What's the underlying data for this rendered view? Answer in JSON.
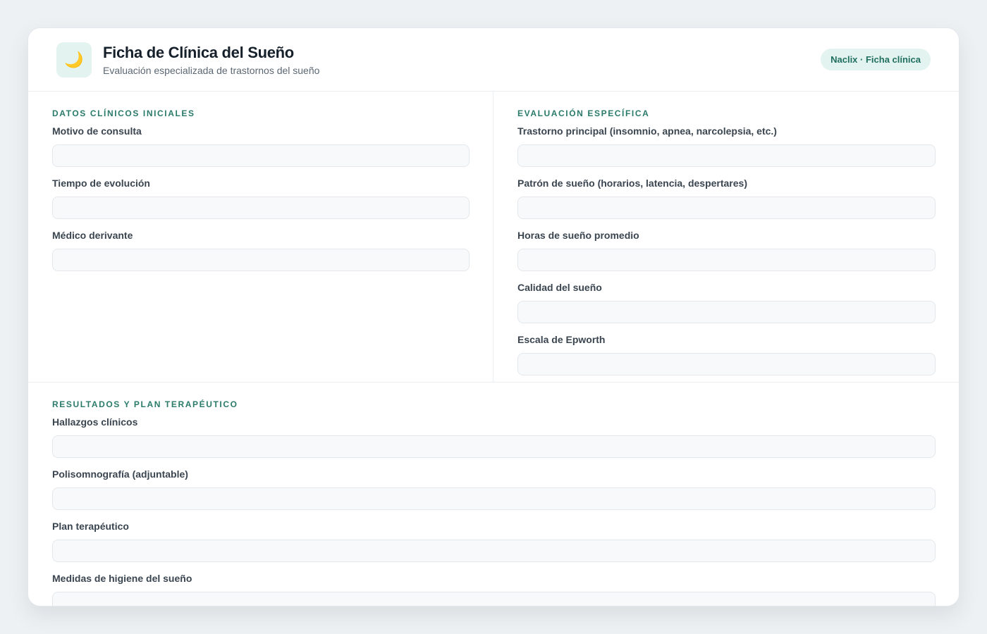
{
  "header": {
    "logo_icon": "🌙",
    "title": "Ficha de Clínica del Sueño",
    "subtitle": "Evaluación especializada de trastornos del sueño",
    "badge": "Naclix · Ficha clínica"
  },
  "colors": {
    "accent": "#2a7a6a",
    "badge_bg": "#e3f3ef",
    "page_bg": "#eef1f4"
  },
  "sections": {
    "initial": {
      "title": "DATOS CLÍNICOS INICIALES",
      "fields": [
        {
          "label": "Motivo de consulta",
          "value": ""
        },
        {
          "label": "Tiempo de evolución",
          "value": ""
        },
        {
          "label": "Médico derivante",
          "value": ""
        }
      ]
    },
    "specific": {
      "title": "EVALUACIÓN ESPECÍFICA",
      "fields": [
        {
          "label": "Trastorno principal (insomnio, apnea, narcolepsia, etc.)",
          "value": ""
        },
        {
          "label": "Patrón de sueño (horarios, latencia, despertares)",
          "value": ""
        },
        {
          "label": "Horas de sueño promedio",
          "value": ""
        },
        {
          "label": "Calidad del sueño",
          "value": ""
        },
        {
          "label": "Escala de Epworth",
          "value": ""
        }
      ]
    },
    "results": {
      "title": "RESULTADOS Y PLAN TERAPÉUTICO",
      "fields": [
        {
          "label": "Hallazgos clínicos",
          "value": ""
        },
        {
          "label": "Polisomnografía (adjuntable)",
          "value": ""
        },
        {
          "label": "Plan terapéutico",
          "value": ""
        },
        {
          "label": "Medidas de higiene del sueño",
          "value": ""
        }
      ]
    }
  }
}
